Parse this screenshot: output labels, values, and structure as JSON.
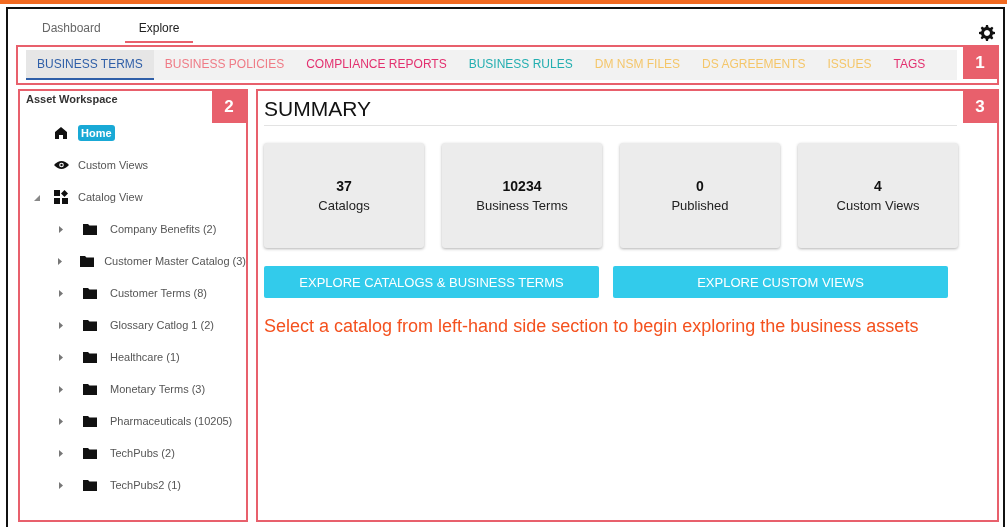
{
  "top_tabs": [
    {
      "label": "Dashboard",
      "selected": false
    },
    {
      "label": "Explore",
      "selected": true
    }
  ],
  "category_tabs": {
    "callout": "1",
    "items": [
      {
        "label": "BUSINESS TERMS",
        "color": "#2f5fa8",
        "selected": true
      },
      {
        "label": "BUSINESS POLICIES",
        "color": "#ef7b86",
        "selected": false
      },
      {
        "label": "COMPLIANCE REPORTS",
        "color": "#e3306f",
        "selected": false
      },
      {
        "label": "BUSINESS RULES",
        "color": "#23aeb0",
        "selected": false
      },
      {
        "label": "DM NSM FILES",
        "color": "#f4c66a",
        "selected": false
      },
      {
        "label": "DS AGREEMENTS",
        "color": "#f4c66a",
        "selected": false
      },
      {
        "label": "ISSUES",
        "color": "#f4c66a",
        "selected": false
      },
      {
        "label": "TAGS",
        "color": "#e3306f",
        "selected": false
      }
    ]
  },
  "sidebar": {
    "title": "Asset Workspace",
    "callout": "2",
    "items": [
      {
        "label": "Home",
        "kind": "home",
        "selected": true
      },
      {
        "label": "Custom Views",
        "kind": "views",
        "selected": false
      },
      {
        "label": "Catalog View",
        "kind": "catalogs",
        "selected": false,
        "expanded": true,
        "children": [
          {
            "label": "Company Benefits (2)",
            "expanded": false
          },
          {
            "label": "Customer Master Catalog (3)",
            "expanded": false
          },
          {
            "label": "Customer Terms (8)",
            "expanded": false
          },
          {
            "label": "Glossary Catlog 1 (2)",
            "expanded": false
          },
          {
            "label": "Healthcare (1)",
            "expanded": false
          },
          {
            "label": "Monetary Terms (3)",
            "expanded": false
          },
          {
            "label": "Pharmaceuticals (10205)",
            "expanded": false
          },
          {
            "label": "TechPubs (2)",
            "expanded": false
          },
          {
            "label": "TechPubs2 (1)",
            "expanded": false
          }
        ]
      }
    ]
  },
  "summary": {
    "title": "SUMMARY",
    "callout": "3",
    "cards": [
      {
        "value": "37",
        "label": "Catalogs"
      },
      {
        "value": "10234",
        "label": "Business Terms"
      },
      {
        "value": "0",
        "label": "Published"
      },
      {
        "value": "4",
        "label": "Custom Views"
      }
    ],
    "buttons": [
      "EXPLORE CATALOGS & BUSINESS TERMS",
      "EXPLORE CUSTOM VIEWS"
    ],
    "message": "Select a catalog from left-hand side section to begin exploring the business assets"
  }
}
